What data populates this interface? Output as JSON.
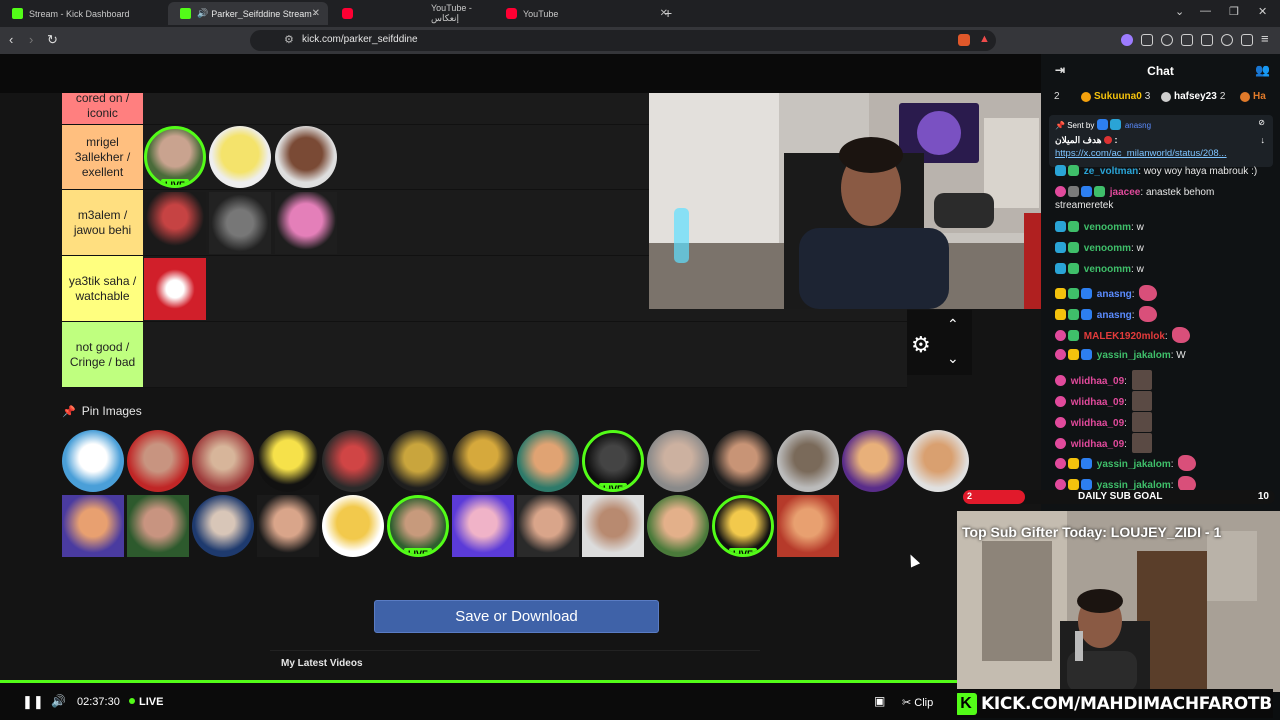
{
  "browser": {
    "tabs": [
      {
        "title": "Stream - Kick Dashboard",
        "favicon": "kick"
      },
      {
        "title": "Parker_Seifddine Stream - Wa",
        "favicon": "kick",
        "active": true
      },
      {
        "title": "YouTube - إنعكاس",
        "favicon": "youtube"
      },
      {
        "title": "YouTube",
        "favicon": "youtube"
      }
    ],
    "url": "kick.com/parker_seifddine"
  },
  "tierlist": {
    "rows": [
      {
        "label": "cored on / iconic",
        "color": "#ff7f7f"
      },
      {
        "label": "mrigel 3allekher / exellent",
        "color": "#ffbf7f"
      },
      {
        "label": "m3alem / jawou behi",
        "color": "#ffdf80"
      },
      {
        "label": "ya3tik saha / watchable",
        "color": "#ffff7f"
      },
      {
        "label": "not good / Cringe / bad",
        "color": "#bfff7f"
      }
    ],
    "live_tag": "LIVE",
    "pin_header": "Pin Images",
    "save_button": "Save or Download",
    "latest_videos": "My Latest Videos"
  },
  "chat": {
    "title": "Chat",
    "top_gifters": [
      {
        "rank": "2",
        "name": "Sukuuna0",
        "count": "3"
      },
      {
        "name": "hafsey23",
        "count": "2"
      },
      {
        "name": "Ha"
      }
    ],
    "pinned": {
      "sent_by_label": "Sent by",
      "sent_by_user": "anasng",
      "text": "هدف الميلان",
      "link": "https://x.com/ac_milanworld/status/208..."
    },
    "messages": [
      {
        "user": "ze_voltman",
        "color": "#2aa4d6",
        "text": "woy woy haya mabrouk :)"
      },
      {
        "user": "jaacee",
        "color": "#e14a9c",
        "text": "anastek behom streameretek"
      },
      {
        "user": "venoomm",
        "color": "#3fbf6a",
        "text": "w"
      },
      {
        "user": "venoomm",
        "color": "#3fbf6a",
        "text": "w"
      },
      {
        "user": "venoomm",
        "color": "#3fbf6a",
        "text": "w"
      },
      {
        "user": "anasng",
        "color": "#5b8cff",
        "text": ""
      },
      {
        "user": "anasng",
        "color": "#5b8cff",
        "text": ""
      },
      {
        "user": "MALEK1920mlok",
        "color": "#e33b3b",
        "text": ""
      },
      {
        "user": "yassin_jakalom",
        "color": "#3fbf6a",
        "text": "W"
      },
      {
        "user": "wlidhaa_09",
        "color": "#e14a9c",
        "text": ""
      },
      {
        "user": "wlidhaa_09",
        "color": "#e14a9c",
        "text": ""
      },
      {
        "user": "wlidhaa_09",
        "color": "#e14a9c",
        "text": ""
      },
      {
        "user": "wlidhaa_09",
        "color": "#e14a9c",
        "text": ""
      },
      {
        "user": "yassin_jakalom",
        "color": "#3fbf6a",
        "text": ""
      },
      {
        "user": "yassin_jakalom",
        "color": "#3fbf6a",
        "text": ""
      }
    ]
  },
  "overlay": {
    "sub_goal_label": "DAILY SUB GOAL",
    "sub_goal_current": "2",
    "sub_goal_target": "10",
    "top_gifter": "Top Sub Gifter Today: LOUJEY_ZIDI - 1",
    "kick_url": "KICK.COM/MAHDIMACHFAROTB"
  },
  "player": {
    "time": "02:37:30",
    "live_label": "LIVE",
    "clip_label": "Clip"
  }
}
